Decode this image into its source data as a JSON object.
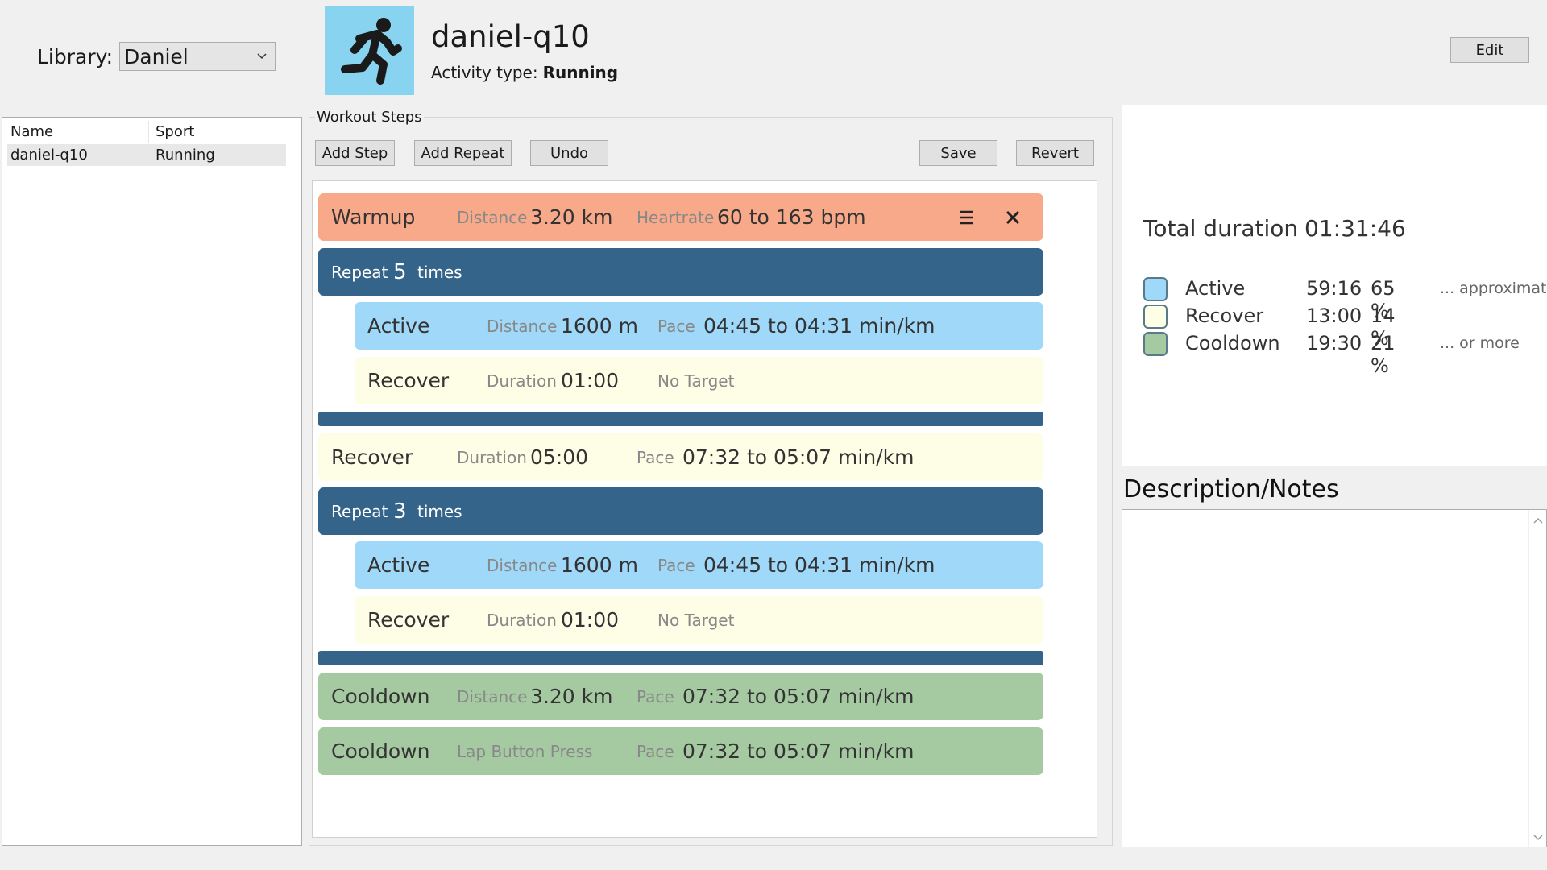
{
  "library": {
    "label": "Library:",
    "selected": "Daniel"
  },
  "list": {
    "columns": [
      "Name",
      "Sport"
    ],
    "rows": [
      {
        "name": "daniel-q10",
        "sport": "Running"
      }
    ]
  },
  "activity": {
    "name": "daniel-q10",
    "type_label": "Activity type:",
    "type_value": "Running"
  },
  "toolbar": {
    "edit": "Edit",
    "group_label": "Workout Steps",
    "add_step": "Add Step",
    "add_repeat": "Add Repeat",
    "undo": "Undo",
    "save": "Save",
    "revert": "Revert"
  },
  "steps": {
    "warmup": {
      "name": "Warmup",
      "k1": "Distance",
      "v1": "3.20 km",
      "k2": "Heartrate",
      "v2": "60 to 163 bpm"
    },
    "repeat1": {
      "label": "Repeat",
      "count": "5",
      "times": "times"
    },
    "r1_active": {
      "name": "Active",
      "k1": "Distance",
      "v1": "1600 m",
      "k2": "Pace",
      "v2": "04:45 to 04:31 min/km"
    },
    "r1_recover": {
      "name": "Recover",
      "k1": "Duration",
      "v1": "01:00",
      "k2": "No Target"
    },
    "recover": {
      "name": "Recover",
      "k1": "Duration",
      "v1": "05:00",
      "k2": "Pace",
      "v2": "07:32 to 05:07 min/km"
    },
    "repeat2": {
      "label": "Repeat",
      "count": "3",
      "times": "times"
    },
    "r2_active": {
      "name": "Active",
      "k1": "Distance",
      "v1": "1600 m",
      "k2": "Pace",
      "v2": "04:45 to 04:31 min/km"
    },
    "r2_recover": {
      "name": "Recover",
      "k1": "Duration",
      "v1": "01:00",
      "k2": "No Target"
    },
    "cooldown1": {
      "name": "Cooldown",
      "k1": "Distance",
      "v1": "3.20 km",
      "k2": "Pace",
      "v2": "07:32 to 05:07 min/km"
    },
    "cooldown2": {
      "name": "Cooldown",
      "k1": "Lap Button Press",
      "k2": "Pace",
      "v2": "07:32 to 05:07 min/km"
    }
  },
  "summary": {
    "total_label": "Total duration",
    "total_value": "01:31:46",
    "legend": [
      {
        "name": "Active",
        "time": "59:16",
        "pct": "65 %",
        "note": "... approximate",
        "color": "#9fd8f8"
      },
      {
        "name": "Recover",
        "time": "13:00",
        "pct": "14 %",
        "note": "",
        "color": "#fefde6"
      },
      {
        "name": "Cooldown",
        "time": "19:30",
        "pct": "21 %",
        "note": "... or more",
        "color": "#a5c9a1"
      }
    ]
  },
  "description": {
    "title": "Description/Notes"
  },
  "colors": {
    "warmup": "#f7a98a",
    "active": "#9fd8f8",
    "recover": "#fefde6",
    "cooldown": "#a5c9a1",
    "repeat": "#35648a"
  },
  "icons": [
    "running-person-icon",
    "chevron-down-icon",
    "menu-icon",
    "close-icon",
    "scroll-up-icon",
    "scroll-down-icon"
  ]
}
